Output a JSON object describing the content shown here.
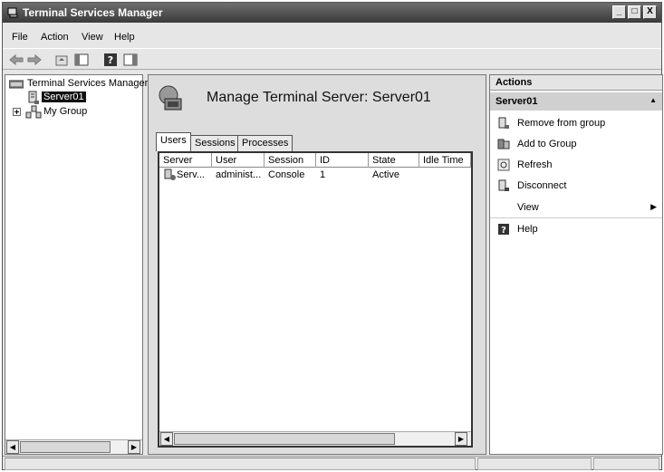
{
  "window": {
    "title": "Terminal Services Manager",
    "buttons": [
      "_",
      "□",
      "X"
    ]
  },
  "menu": [
    "File",
    "Action",
    "View",
    "Help"
  ],
  "tree": {
    "root": "Terminal Services Manager",
    "server": "Server01",
    "group": "My Group"
  },
  "main": {
    "title": "Manage Terminal Server: Server01",
    "tabs": [
      "Users",
      "Sessions",
      "Processes"
    ],
    "columns": [
      "Server",
      "User",
      "Session",
      "ID",
      "State",
      "Idle Time"
    ],
    "rows": [
      {
        "server": "Serv...",
        "user": "administ...",
        "session": "Console",
        "id": "1",
        "state": "Active",
        "idle": ""
      }
    ]
  },
  "actions": {
    "heading": "Actions",
    "section": "Server01",
    "items": [
      {
        "label": "Remove from group",
        "icon": "server-remove-icon"
      },
      {
        "label": "Add to Group",
        "icon": "group-add-icon"
      },
      {
        "label": "Refresh",
        "icon": "refresh-icon"
      },
      {
        "label": "Disconnect",
        "icon": "disconnect-icon"
      },
      {
        "label": "View",
        "icon": "none"
      },
      {
        "label": "Help",
        "icon": "help-icon"
      }
    ]
  }
}
